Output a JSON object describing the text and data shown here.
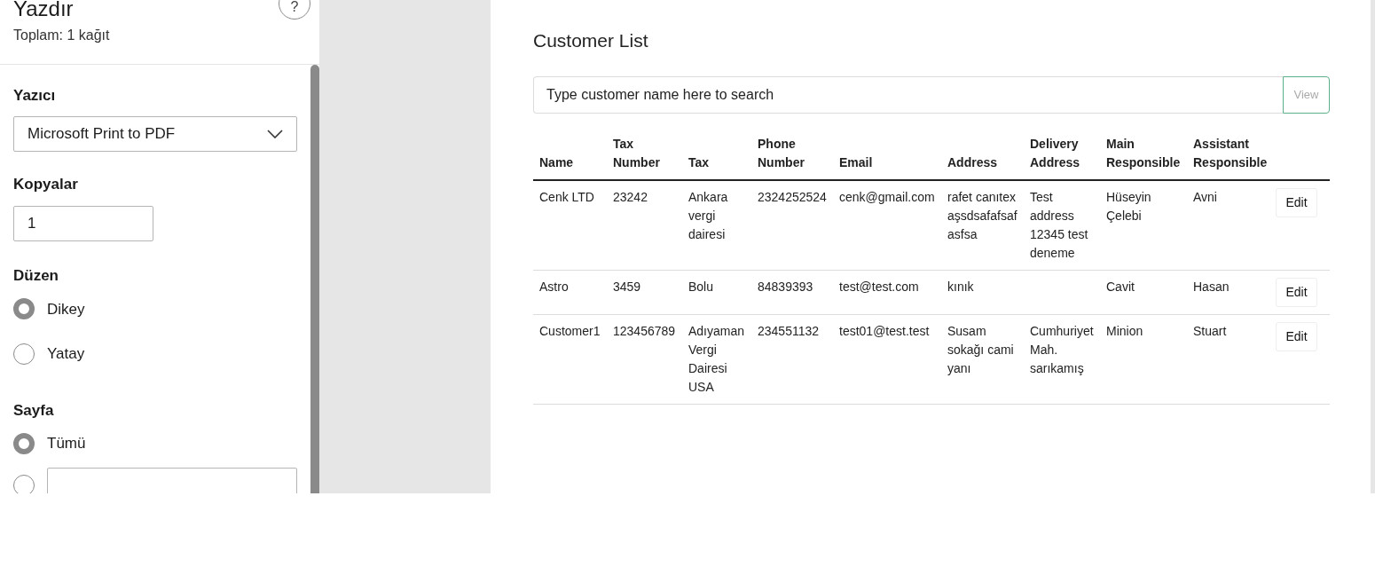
{
  "print_panel": {
    "title": "Yazdır",
    "subtitle": "Toplam: 1 kağıt",
    "help": "?",
    "printer": {
      "label": "Yazıcı",
      "value": "Microsoft Print to PDF"
    },
    "copies": {
      "label": "Kopyalar",
      "value": "1"
    },
    "layout": {
      "label": "Düzen",
      "options": [
        {
          "label": "Dikey",
          "selected": true
        },
        {
          "label": "Yatay",
          "selected": false
        }
      ]
    },
    "pages": {
      "label": "Sayfa",
      "options": [
        {
          "label": "Tümü",
          "selected": true,
          "kind": "label"
        },
        {
          "selected": false,
          "kind": "field"
        }
      ]
    }
  },
  "preview": {
    "title": "Customer List",
    "search": {
      "placeholder": "Type customer name here to search",
      "button": "View"
    },
    "table": {
      "columns": [
        "Name",
        "Tax Number",
        "Tax",
        "Phone Number",
        "Email",
        "Address",
        "Delivery Address",
        "Main Responsible",
        "Assistant Responsible"
      ],
      "rows": [
        {
          "cells": [
            "Cenk LTD",
            "23242",
            "Ankara vergi dairesi",
            "2324252524",
            "cenk@gmail.com",
            "rafet canıtex aşsdsafafsaf asfsa",
            "Test address 12345 test deneme",
            "Hüseyin Çelebi",
            "Avni"
          ],
          "action": "Edit"
        },
        {
          "cells": [
            "Astro",
            "3459",
            "Bolu",
            "84839393",
            "test@test.com",
            "kınık",
            null,
            "Cavit",
            "Hasan"
          ],
          "action": "Edit"
        },
        {
          "cells": [
            "Customer1",
            "123456789",
            "Adıyaman Vergi Dairesi USA",
            "234551132",
            "test01@test.test",
            "Susam sokağı cami yanı",
            "Cumhuriyet Mah. sarıkamış",
            "Minion",
            "Stuart"
          ],
          "action": "Edit"
        }
      ]
    }
  }
}
